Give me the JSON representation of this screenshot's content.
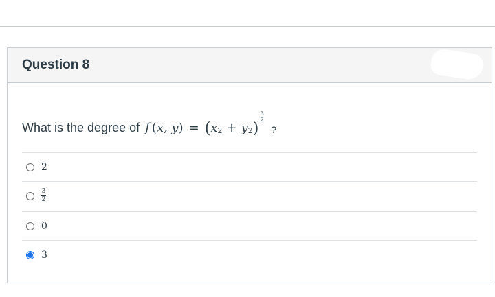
{
  "question": {
    "title": "Question 8",
    "prompt": "What is the degree of",
    "function_name": "f",
    "function_args": "x, y",
    "equals": "=",
    "base_x": "x",
    "base_y": "y",
    "square": "2",
    "plus": "+",
    "exponent_num": "3",
    "exponent_den": "2",
    "question_mark": "?"
  },
  "answers": [
    {
      "label": "2",
      "selected": false
    },
    {
      "label_num": "3",
      "label_den": "2",
      "selected": false
    },
    {
      "label": "0",
      "selected": false
    },
    {
      "label": "3",
      "selected": true
    }
  ],
  "colors": {
    "accent": "#1a73e8",
    "text": "#2d3b45",
    "border": "#c7cdd1",
    "header_bg": "#f5f5f5"
  }
}
